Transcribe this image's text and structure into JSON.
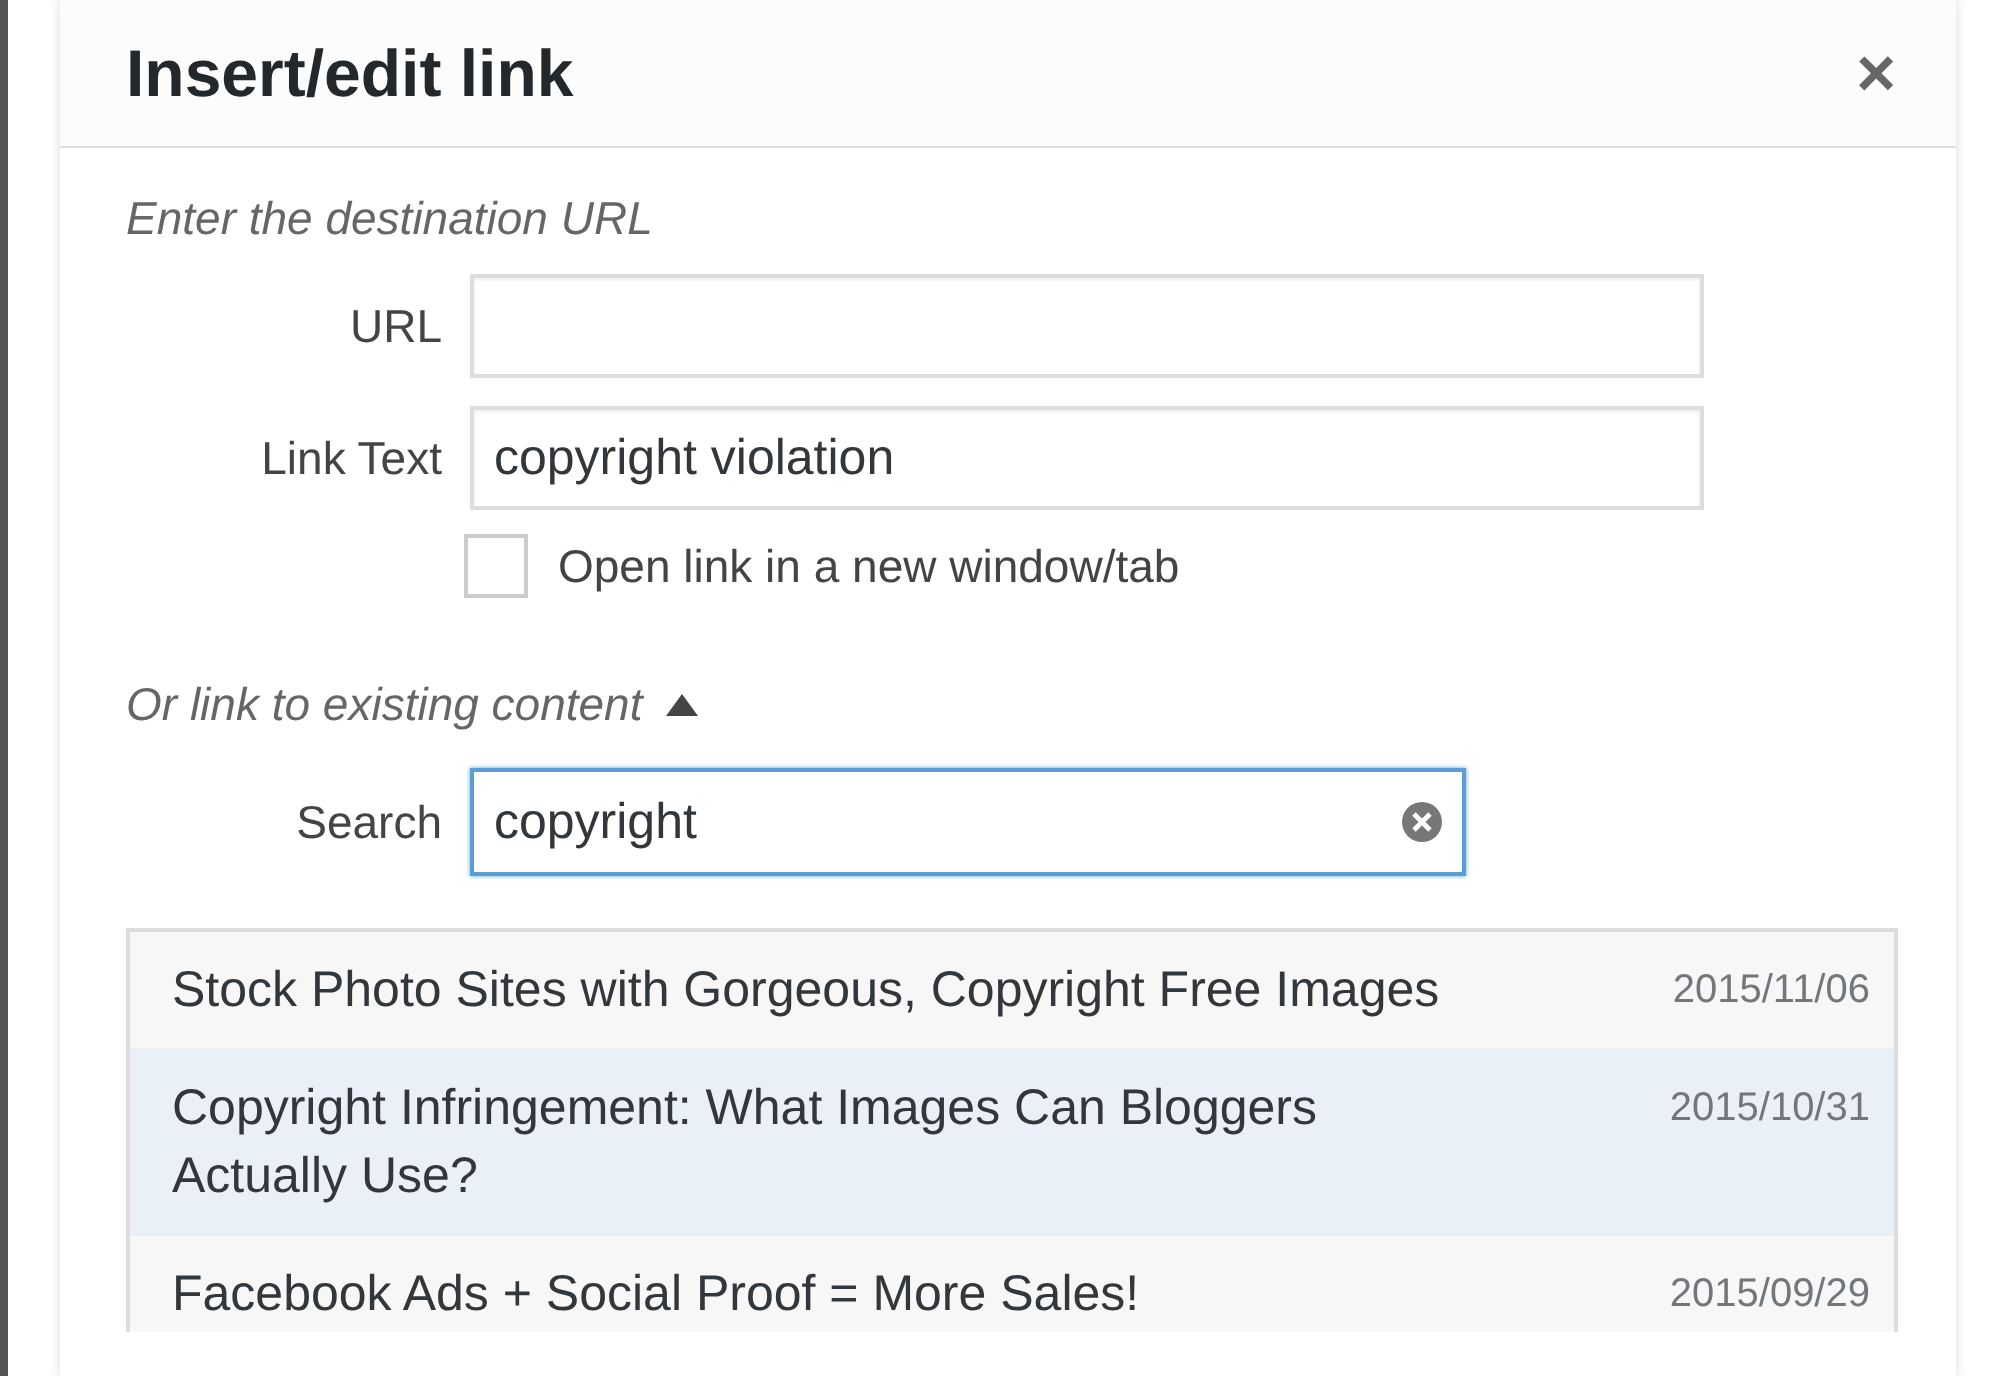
{
  "dialog": {
    "title": "Insert/edit link",
    "close": "×"
  },
  "url_section": {
    "heading": "Enter the destination URL",
    "fields": [
      {
        "label": "URL"
      },
      {
        "label": "Link Text",
        "value": "copyright violation"
      }
    ],
    "new_window": {
      "label": "Open link in a new window/tab",
      "checked": false
    }
  },
  "existing": {
    "heading": "Or link to existing content",
    "expanded": true,
    "search": {
      "label": "Search",
      "value": "copyright"
    },
    "results": [
      {
        "title": "Stock Photo Sites with Gorgeous, Copyright Free Images",
        "date": "2015/11/06",
        "selected": false
      },
      {
        "title": "Copyright Infringement: What Images Can Bloggers Actually Use?",
        "date": "2015/10/31",
        "selected": true
      },
      {
        "title": "Facebook Ads + Social Proof = More Sales!",
        "date": "2015/09/29",
        "selected": false
      }
    ]
  }
}
